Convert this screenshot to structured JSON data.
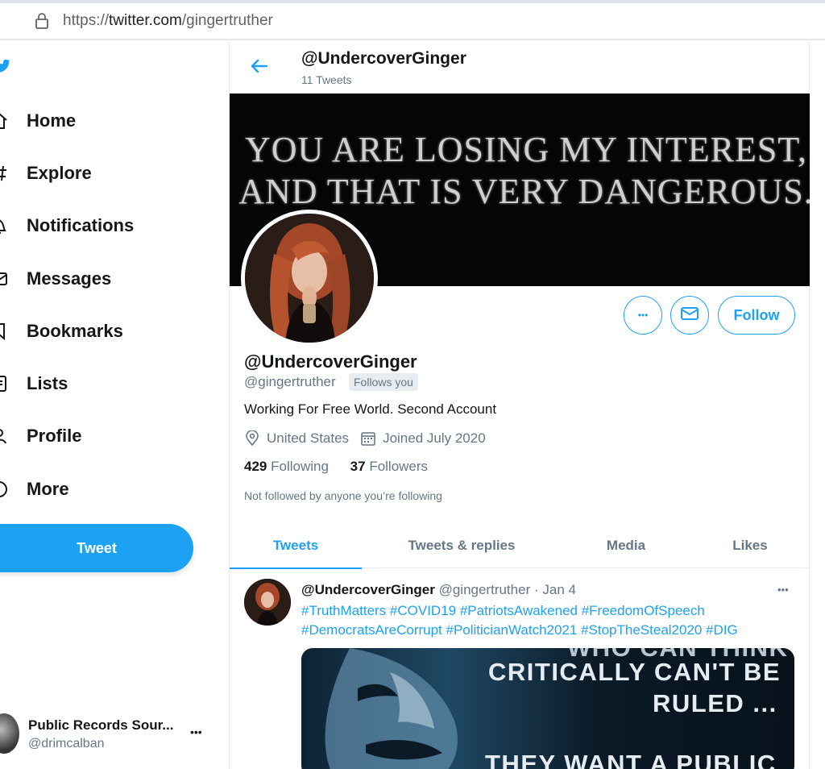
{
  "browser": {
    "url_scheme": "https://",
    "url_host": "twitter.com",
    "url_path": "/gingertruther"
  },
  "sidebar": {
    "items": [
      {
        "label": "Home",
        "icon": "home-icon"
      },
      {
        "label": "Explore",
        "icon": "hashtag-icon"
      },
      {
        "label": "Notifications",
        "icon": "bell-icon"
      },
      {
        "label": "Messages",
        "icon": "envelope-icon"
      },
      {
        "label": "Bookmarks",
        "icon": "bookmark-icon"
      },
      {
        "label": "Lists",
        "icon": "list-icon"
      },
      {
        "label": "Profile",
        "icon": "person-icon"
      },
      {
        "label": "More",
        "icon": "more-circle-icon"
      }
    ],
    "tweet_button": "Tweet",
    "account": {
      "name": "Public Records Sour...",
      "handle": "@drimcalban",
      "more": "•••"
    }
  },
  "header": {
    "name": "@UndercoverGinger",
    "tweet_count": "11 Tweets"
  },
  "banner": {
    "line1": "YOU ARE LOSING MY INTEREST,",
    "line2": "AND THAT IS VERY DANGEROUS."
  },
  "profile": {
    "more_label": "•••",
    "follow_label": "Follow",
    "name": "@UndercoverGinger",
    "handle": "@gingertruther",
    "follows_you": "Follows you",
    "bio": "Working For Free World. Second Account",
    "location": "United States",
    "joined": "Joined July 2020",
    "following_count": "429",
    "following_label": "Following",
    "followers_count": "37",
    "followers_label": "Followers",
    "not_followed": "Not followed by anyone you’re following"
  },
  "tabs": [
    {
      "label": "Tweets",
      "active": true
    },
    {
      "label": "Tweets & replies",
      "active": false
    },
    {
      "label": "Media",
      "active": false
    },
    {
      "label": "Likes",
      "active": false
    }
  ],
  "tweet": {
    "name": "@UndercoverGinger",
    "handle": "@gingertruther",
    "separator": "·",
    "date": "Jan 4",
    "more": "•••",
    "hashtags_line1": "#TruthMatters #COVID19 #PatriotsAwakened #FreedomOfSpeech",
    "hashtags_line2": "#DemocratsAreCorrupt #PoliticianWatch2021 #StopTheSteal2020 #DIG",
    "image_text": {
      "line0": "WHO CAN THINK",
      "line1": "CRITICALLY CAN'T BE",
      "line2": "RULED ...",
      "line3": "THEY WANT A PUBLIC"
    }
  },
  "colors": {
    "accent": "#1da1f2",
    "text": "#14171a",
    "muted": "#657786"
  }
}
